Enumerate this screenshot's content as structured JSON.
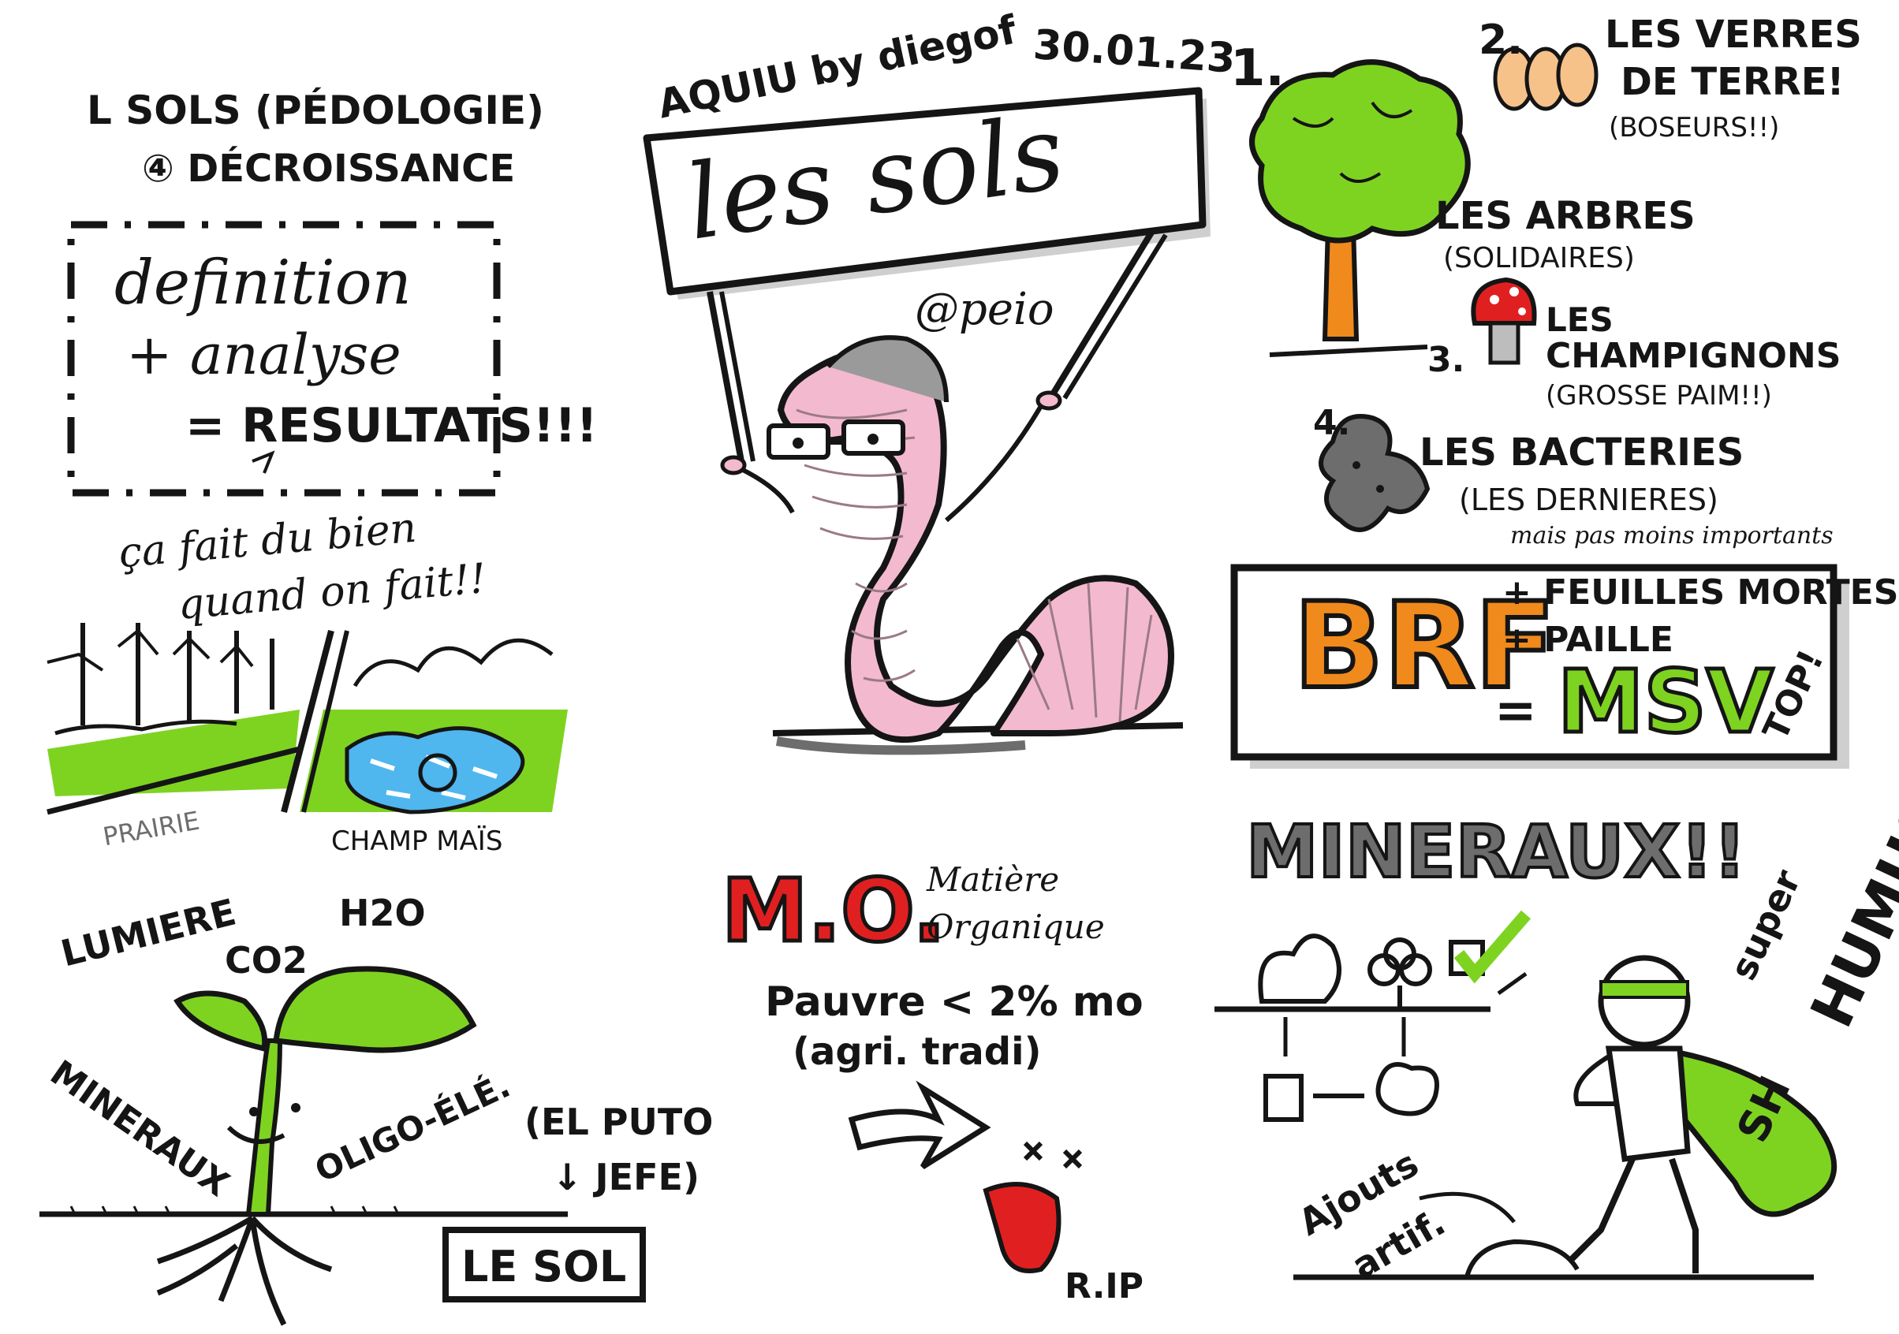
{
  "header": {
    "author": "AQUIU by diegof",
    "date": "30.01.23",
    "title": "les sols",
    "handle": "@peio"
  },
  "left": {
    "topic_line1": "L SOLS (PÉDOLOGIE)",
    "topic_line2": "④ DÉCROISSANCE",
    "box_line1": "definition",
    "box_line2": "+ analyse",
    "box_line3": "= RESULTATS!!!",
    "quote_line1": "ça fait du bien",
    "quote_line2": "quand on fait!!",
    "prairie_label": "PRAIRIE",
    "champ_label": "CHAMP MAÏS"
  },
  "plant": {
    "lumiere": "LUMIERE",
    "co2": "CO2",
    "h2o": "H2O",
    "mineraux": "MINERAUX",
    "oligo": "OLIGO-ÉLÉ.",
    "el_puto": "(EL PUTO",
    "jefe": "↓ JEFE)",
    "le_sol": "LE SOL"
  },
  "right_list": {
    "n1": "1.",
    "n2": "2.",
    "vers_line1": "LES VERRES",
    "vers_line2": "DE TERRE!",
    "vers_line3": "(BOSEURS!!)",
    "arbres_line1": "LES ARBRES",
    "arbres_line2": "(SOLIDAIRES)",
    "n3": "3.",
    "champ_line1": "LES",
    "champ_line2": "CHAMPIGNONS",
    "champ_line3": "(GROSSE PAIM!!)",
    "n4": "4.",
    "bact_line1": "LES BACTERIES",
    "bact_line2": "(LES DERNIERES)",
    "bact_line3": "mais pas moins importants"
  },
  "brf": {
    "brf": "BRF",
    "line1": "+ FEUILLES MORTES",
    "line2": "+ PAILLE",
    "eq": "=",
    "msv": "MSV",
    "top": "TOP!"
  },
  "mo": {
    "mo": "M.O.",
    "matiere": "Matière",
    "organique": "Organique",
    "pauvre": "Pauvre < 2% mo",
    "agri": "(agri. tradi)",
    "rip": "R.IP"
  },
  "mineraux": {
    "title": "MINERAUX!!",
    "super": "super",
    "humus": "HUMUS!!",
    "sh": "SH",
    "ajouts": "Ajouts",
    "artif": "artif."
  },
  "colors": {
    "ink": "#151515",
    "green": "#7ed321",
    "pink": "#f3b9cf",
    "orange": "#f08a1c",
    "red": "#e02020",
    "blue": "#4fb6ee",
    "grey": "#6d6d6d"
  }
}
